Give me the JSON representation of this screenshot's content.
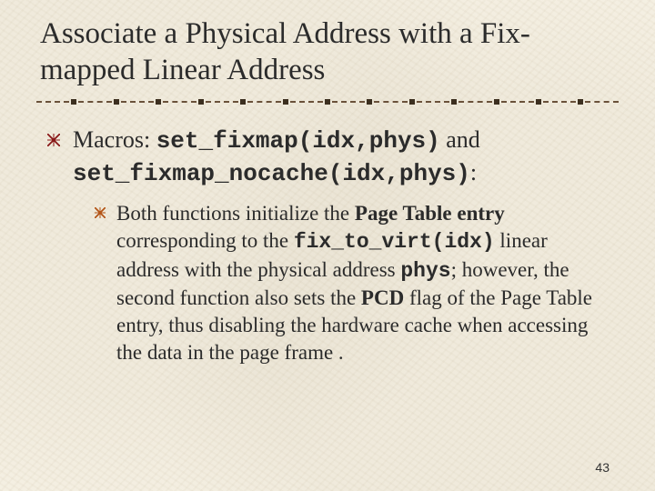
{
  "title": "Associate a Physical Address with a Fix-mapped Linear Address",
  "bullet1": {
    "pre": "Macros: ",
    "code1": "set_fixmap(idx,phys)",
    "mid": " and ",
    "code2": "set_fixmap_nocache(idx,phys)",
    "post": ":"
  },
  "bullet2": {
    "t1": "Both functions initialize the ",
    "b1": "Page Table entry",
    "t2": " corresponding to the ",
    "c1": "fix_to_virt(idx)",
    "t3": " linear address with the physical address ",
    "c2": "phys",
    "t4": "; however, the second function also sets the ",
    "b2": "PCD",
    "t5": " flag of the Page Table entry, thus disabling the hardware cache when accessing the data in the page frame ."
  },
  "page_number": "43"
}
